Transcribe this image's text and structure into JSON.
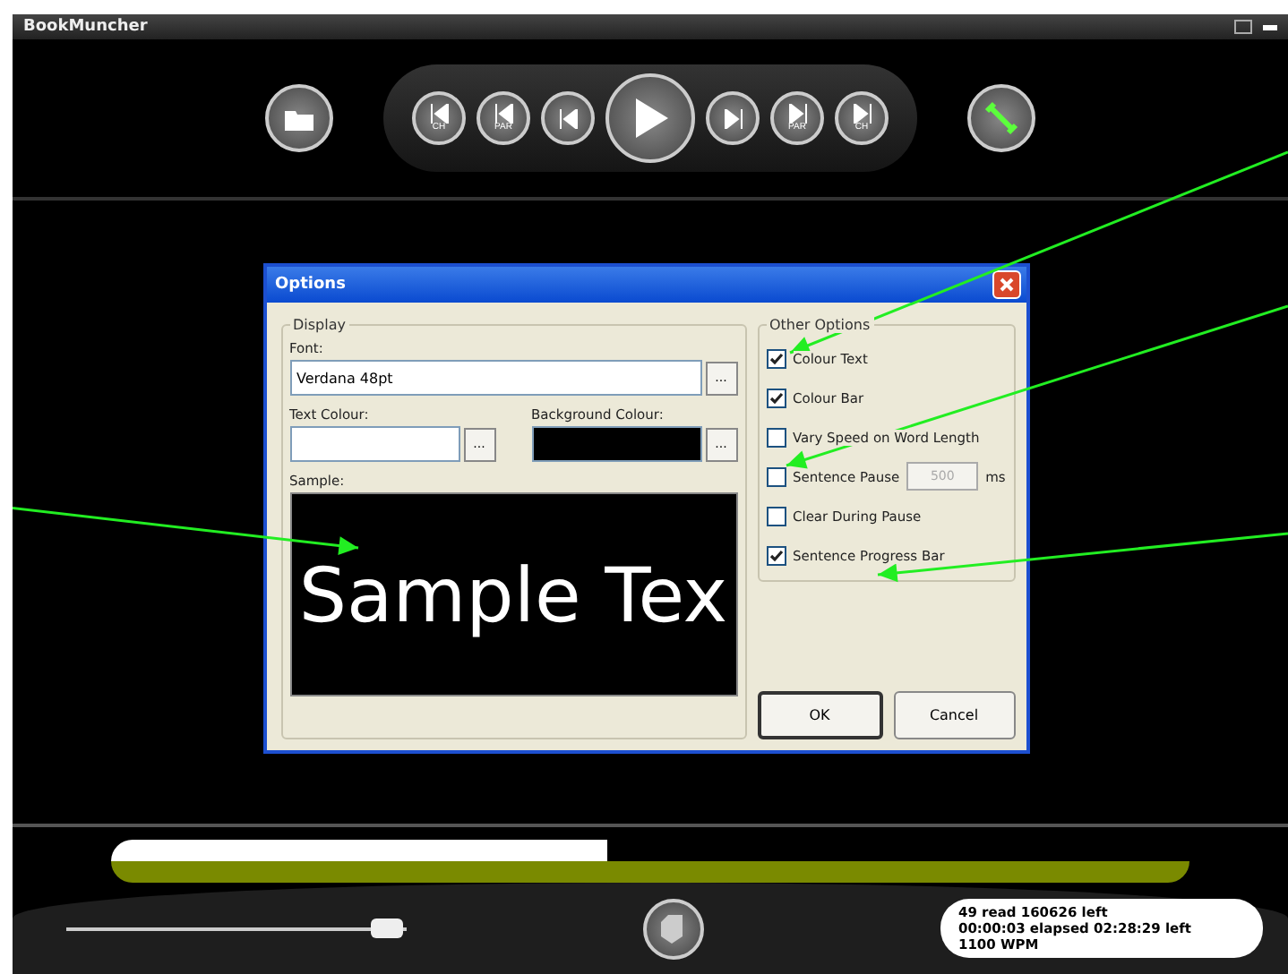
{
  "window": {
    "title": "BookMuncher"
  },
  "toolbar": [
    {
      "kind": "open"
    },
    {
      "kind": "group",
      "buttons": [
        {
          "kind": "back",
          "label": "CH"
        },
        {
          "kind": "back",
          "label": "PAR"
        },
        {
          "kind": "back"
        },
        {
          "kind": "play"
        },
        {
          "kind": "forward"
        },
        {
          "kind": "forward",
          "label": "PAR"
        },
        {
          "kind": "forward",
          "label": "CH"
        }
      ]
    },
    {
      "kind": "settings"
    }
  ],
  "dialog": {
    "title": "Options",
    "display": {
      "legend": "Display",
      "font_label": "Font:",
      "font_value": "Verdana 48pt",
      "colours": [
        {
          "label": "Text Colour:",
          "color": "#ffffff"
        },
        {
          "label": "Background Colour:",
          "color": "#000000"
        }
      ],
      "browse": "...",
      "sample_label": "Sample:",
      "sample_text": "Sample Tex"
    },
    "other": {
      "legend": "Other Options",
      "options": [
        {
          "kind": "checkbox",
          "label": "Colour Text",
          "checked": true
        },
        {
          "kind": "checkbox",
          "label": "Colour Bar",
          "checked": true
        },
        {
          "kind": "checkbox",
          "label": "Vary Speed on Word Length",
          "checked": false
        },
        {
          "kind": "spin",
          "label": "Sentence Pause",
          "checked": false,
          "value": "500",
          "unit": "ms"
        },
        {
          "kind": "checkbox",
          "label": "Clear During Pause",
          "checked": false
        },
        {
          "kind": "checkbox",
          "label": "Sentence Progress Bar",
          "checked": true
        }
      ]
    },
    "buttons": [
      {
        "label": "OK",
        "default": true
      },
      {
        "label": "Cancel",
        "default": false
      }
    ]
  },
  "progress": {
    "word": {
      "level": 0.46
    },
    "sentence": {
      "level": 1
    }
  },
  "speed_slider": {
    "level": 0.94
  },
  "status": [
    "49 read   160626 left",
    "00:00:03 elapsed   02:28:29 left",
    "1100 WPM"
  ]
}
